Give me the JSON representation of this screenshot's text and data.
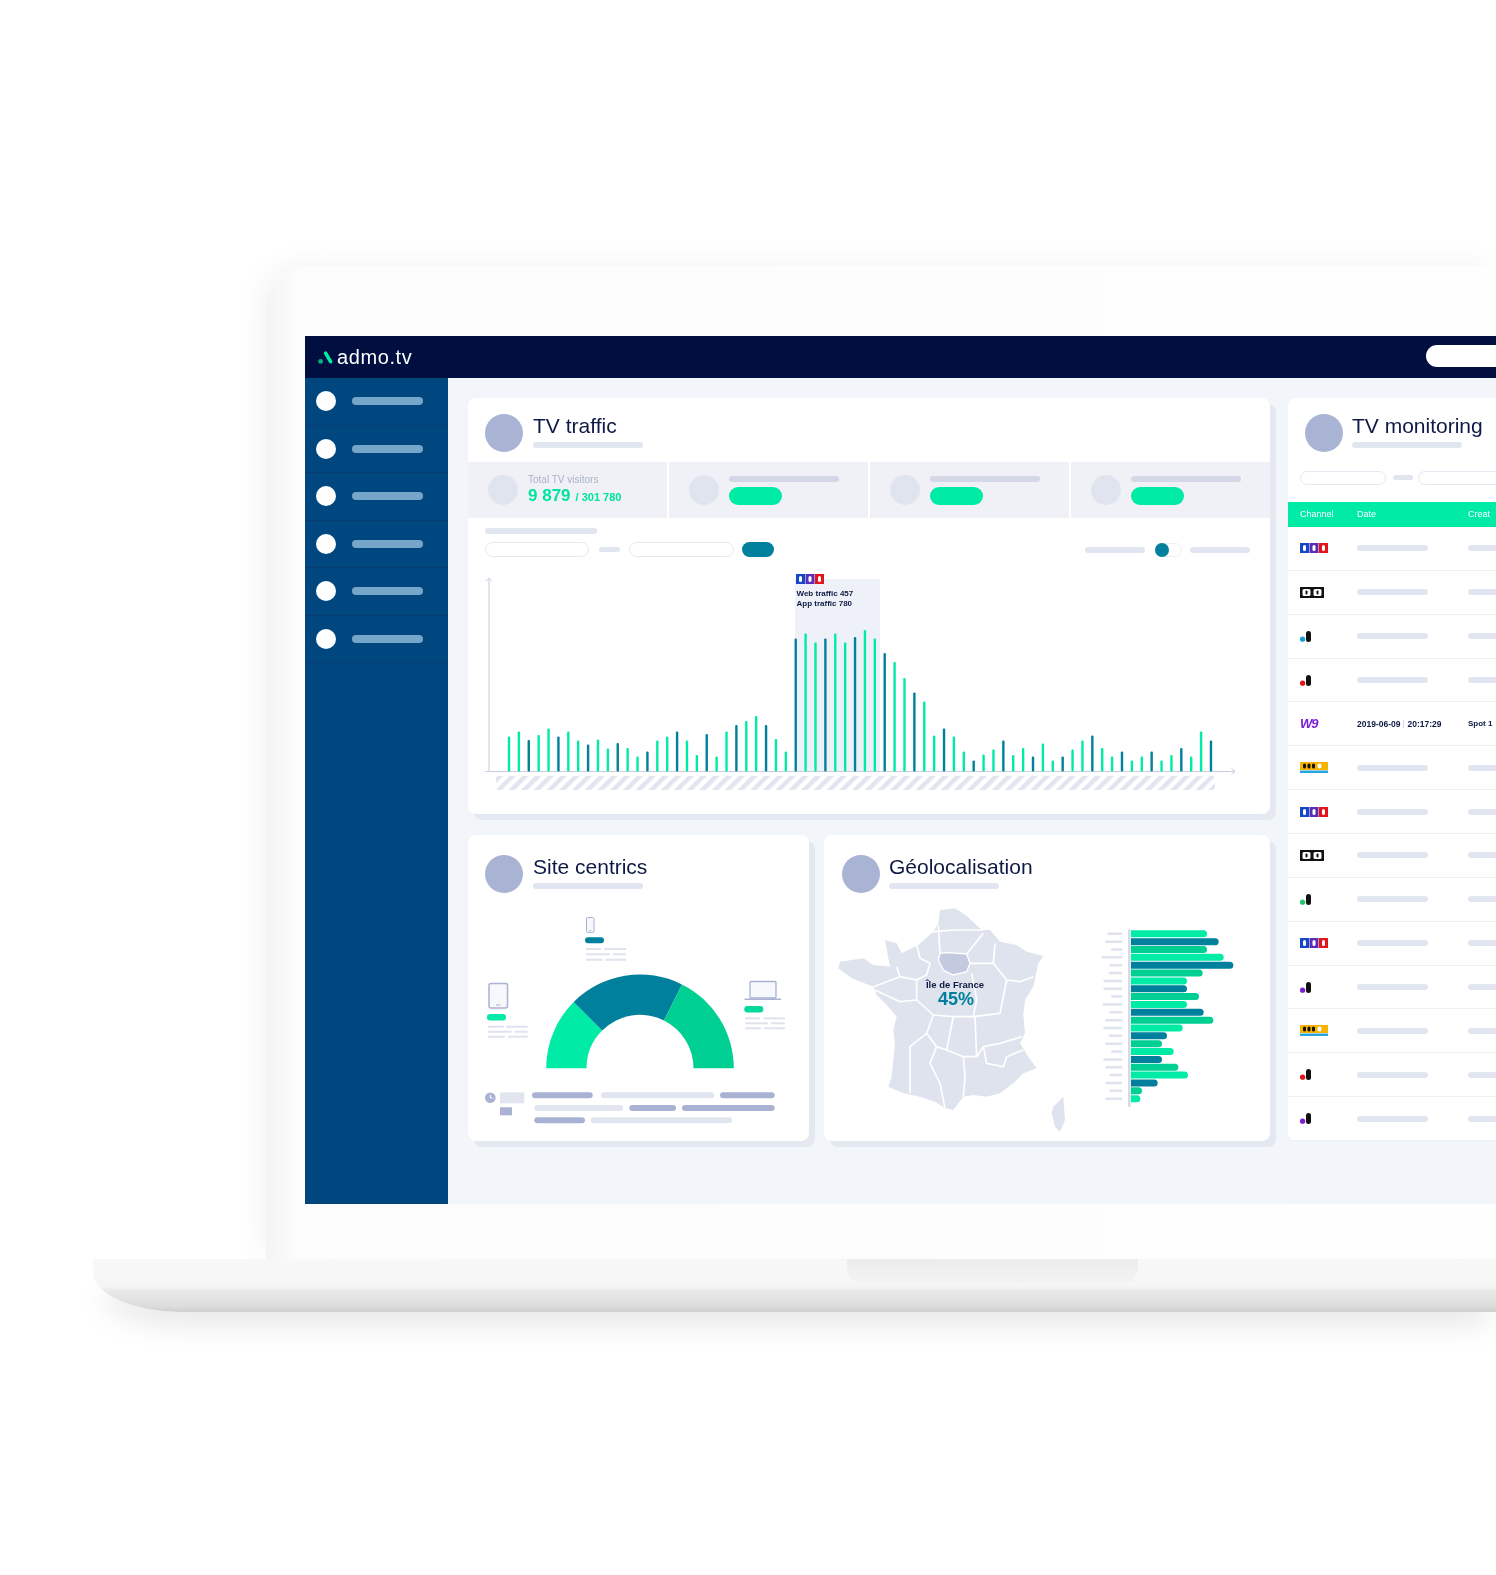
{
  "header": {
    "logo": "admo.tv"
  },
  "tv_traffic": {
    "title": "TV traffic",
    "stats": [
      {
        "kind": "figure",
        "label": "Total TV visitors",
        "value": "9 879",
        "total": "/ 301 780"
      },
      {
        "kind": "placeholder"
      },
      {
        "kind": "placeholder"
      },
      {
        "kind": "placeholder"
      }
    ],
    "toggle": {
      "on": false
    },
    "tooltip": {
      "logo": {
        "kind": "tricolor"
      },
      "lines": [
        "Web traffic 457",
        "App traffic 780"
      ]
    }
  },
  "site_centrics": {
    "title": "Site centrics"
  },
  "geolocalisation": {
    "title": "Géolocalisation",
    "region": "Île de France",
    "share": "45%"
  },
  "tv_monitoring": {
    "title": "TV monitoring",
    "columns": [
      "Channel",
      "Date",
      "Creat"
    ],
    "rows": [
      {
        "kind": "tricolor"
      },
      {
        "kind": "boxed"
      },
      {
        "kind": "dot",
        "color": "#1a9fd6"
      },
      {
        "kind": "dot",
        "color": "#e0161b"
      },
      {
        "kind": "wordmark",
        "logo_text": "W9",
        "date": "2019-06-09",
        "time": "20:17:29",
        "creative": "Spot 1"
      },
      {
        "kind": "strip"
      },
      {
        "kind": "tricolor"
      },
      {
        "kind": "boxed"
      },
      {
        "kind": "dot",
        "color": "#1fc76a"
      },
      {
        "kind": "tricolor"
      },
      {
        "kind": "dot",
        "color": "#7a1fd6"
      },
      {
        "kind": "strip"
      },
      {
        "kind": "dot",
        "color": "#e0161b"
      },
      {
        "kind": "dot",
        "color": "#7a1fd6"
      }
    ]
  }
}
